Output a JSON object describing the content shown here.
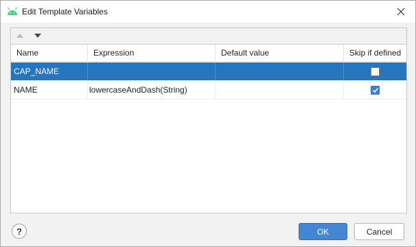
{
  "window": {
    "title": "Edit Template Variables",
    "icon": "android-icon",
    "accent_color": "#3ddc84"
  },
  "toolbar": {
    "move_up_icon": "triangle-up-icon",
    "move_down_icon": "triangle-down-icon"
  },
  "table": {
    "columns": [
      "Name",
      "Expression",
      "Default value",
      "Skip if defined"
    ],
    "rows": [
      {
        "name": "CAP_NAME",
        "expression": "",
        "default_value": "",
        "skip_if_defined": false,
        "selected": true
      },
      {
        "name": "NAME",
        "expression": "lowercaseAndDash(String)",
        "default_value": "",
        "skip_if_defined": true,
        "selected": false
      }
    ],
    "selection_color": "#2675bf"
  },
  "footer": {
    "help_label": "?",
    "ok_label": "OK",
    "cancel_label": "Cancel",
    "ok_color": "#4287d4"
  }
}
